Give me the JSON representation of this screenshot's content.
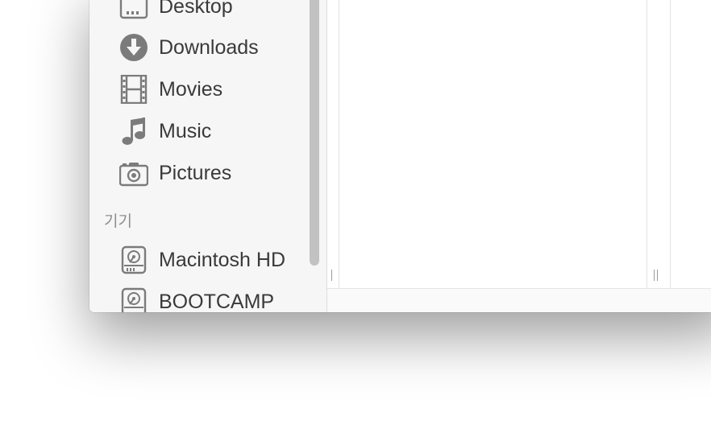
{
  "sidebar": {
    "favorites": [
      {
        "label": "Desktop",
        "icon": "desktop-folder-icon"
      },
      {
        "label": "Downloads",
        "icon": "downloads-icon"
      },
      {
        "label": "Movies",
        "icon": "movies-icon"
      },
      {
        "label": "Music",
        "icon": "music-icon"
      },
      {
        "label": "Pictures",
        "icon": "camera-icon"
      }
    ],
    "devices_header": "기기",
    "devices": [
      {
        "label": "Macintosh HD",
        "icon": "hard-drive-icon"
      },
      {
        "label": "BOOTCAMP",
        "icon": "hard-drive-icon"
      }
    ]
  },
  "colors": {
    "sidebar_bg": "#f6f6f6",
    "icon_gray": "#7b7b7b",
    "text": "#3a3a3a",
    "section_header": "#8e8e8e"
  }
}
